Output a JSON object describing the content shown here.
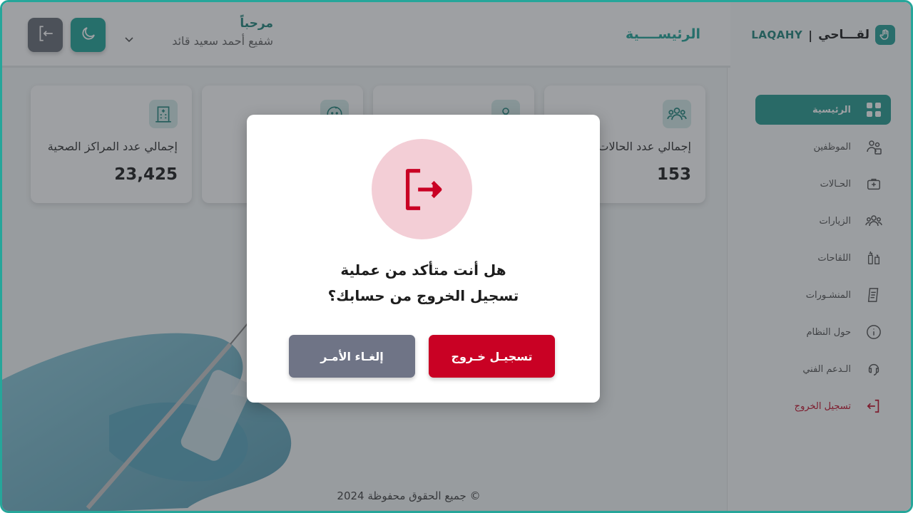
{
  "brand": {
    "arabic": "لقـــاحي",
    "separator": "|",
    "latin": "LAQAHY"
  },
  "header": {
    "page_title": "الرئيســــية",
    "greeting": "مرحباً",
    "user_name": "شفيع أحمد سعيد قائد"
  },
  "sidebar": {
    "items": [
      {
        "label": "الرئيسية",
        "icon": "grid-icon",
        "active": true
      },
      {
        "label": "الموظفين",
        "icon": "staff-icon"
      },
      {
        "label": "الحـالات",
        "icon": "medical-kit-icon"
      },
      {
        "label": "الزيارات",
        "icon": "users-icon"
      },
      {
        "label": "اللقاحات",
        "icon": "vaccine-icon"
      },
      {
        "label": "المنشـورات",
        "icon": "document-icon"
      },
      {
        "label": "حول النظام",
        "icon": "info-icon"
      },
      {
        "label": "الـدعم الفني",
        "icon": "support-icon"
      },
      {
        "label": "تسجيل الخروج",
        "icon": "logout-icon"
      }
    ]
  },
  "cards": [
    {
      "label": "إجمالي عدد المراكز الصحية",
      "value": "23,425",
      "icon": "hospital-icon"
    },
    {
      "label": "",
      "value": "",
      "icon": "baby-icon"
    },
    {
      "label": "",
      "value": "",
      "icon": "person-icon"
    },
    {
      "label": "إجمالي عدد الحالات",
      "value": "153",
      "icon": "users-icon"
    }
  ],
  "footer": "جميع الحقوق محفوظة 2024 ©",
  "modal": {
    "line1": "هل أنت متأكد من عملية",
    "line2": "تسجيل الخروج من حسابك؟",
    "confirm_label": "تسجيـل خـروج",
    "cancel_label": "إلغـاء الأمـر"
  },
  "colors": {
    "primary": "#26a69a",
    "danger": "#c90124",
    "cancel": "#6f7486"
  }
}
